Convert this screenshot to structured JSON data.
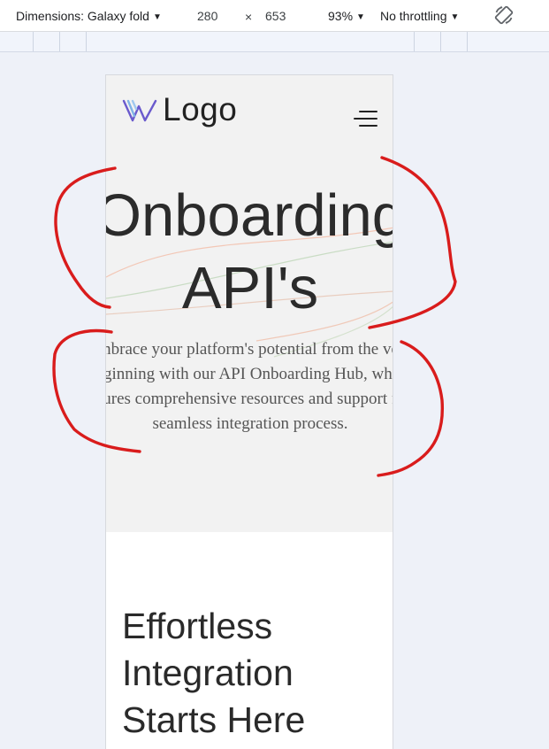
{
  "toolbar": {
    "dimensions_label": "Dimensions: Galaxy fold",
    "width": "280",
    "separator": "×",
    "height": "653",
    "zoom": "93%",
    "throttling": "No throttling",
    "rotate_icon": "rotate-icon"
  },
  "page": {
    "logo_text": "Logo",
    "hero_title_line1": "Onboarding",
    "hero_title_line2": "API's",
    "hero_description": "Embrace your platform's potential from the very beginning with our API Onboarding Hub, which features comprehensive resources and support for a seamless integration process.",
    "section_title": "Effortless Integration Starts Here"
  },
  "colors": {
    "annotation": "#d91c1c",
    "hero_bg": "#f2f2f2",
    "canvas_bg": "#eef1f8"
  }
}
